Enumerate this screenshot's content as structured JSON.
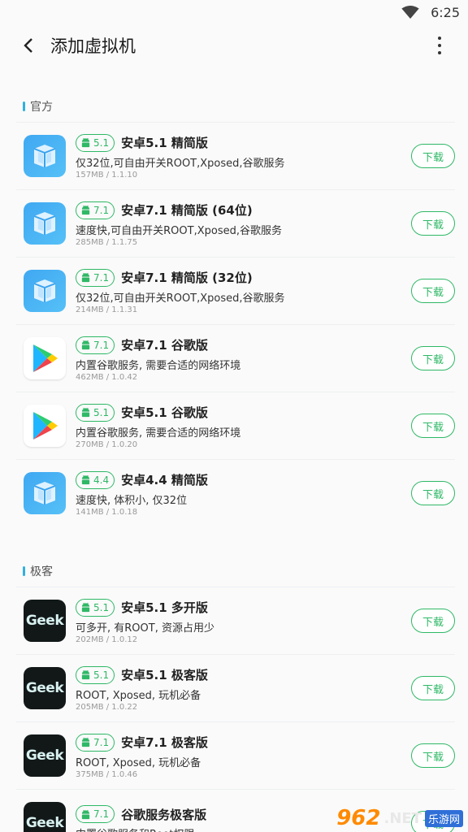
{
  "status": {
    "time": "6:25"
  },
  "header": {
    "title": "添加虚拟机"
  },
  "sections": [
    {
      "title": "官方",
      "items": [
        {
          "icon": "box-icon",
          "version": "5.1",
          "name": "安卓5.1 精简版",
          "desc": "仅32位,可自由开关ROOT,Xposed,谷歌服务",
          "meta": "157MB / 1.1.10",
          "button": "下载"
        },
        {
          "icon": "box-icon",
          "version": "7.1",
          "name": "安卓7.1 精简版 (64位)",
          "desc": "速度快,可自由开关ROOT,Xposed,谷歌服务",
          "meta": "285MB / 1.1.75",
          "button": "下载"
        },
        {
          "icon": "box-icon",
          "version": "7.1",
          "name": "安卓7.1 精简版 (32位)",
          "desc": "仅32位,可自由开关ROOT,Xposed,谷歌服务",
          "meta": "214MB / 1.1.31",
          "button": "下载"
        },
        {
          "icon": "play-icon",
          "version": "7.1",
          "name": "安卓7.1 谷歌版",
          "desc": "内置谷歌服务, 需要合适的网络环境",
          "meta": "462MB / 1.0.42",
          "button": "下载"
        },
        {
          "icon": "play-icon",
          "version": "5.1",
          "name": "安卓5.1 谷歌版",
          "desc": "内置谷歌服务, 需要合适的网络环境",
          "meta": "270MB / 1.0.20",
          "button": "下载"
        },
        {
          "icon": "box-icon",
          "version": "4.4",
          "name": "安卓4.4 精简版",
          "desc": "速度快, 体积小, 仅32位",
          "meta": "141MB / 1.0.18",
          "button": "下载"
        }
      ]
    },
    {
      "title": "极客",
      "items": [
        {
          "icon": "geek-icon",
          "version": "5.1",
          "name": "安卓5.1 多开版",
          "desc": "可多开, 有ROOT, 资源占用少",
          "meta": "202MB / 1.0.12",
          "button": "下载"
        },
        {
          "icon": "geek-icon",
          "version": "5.1",
          "name": "安卓5.1 极客版",
          "desc": "ROOT, Xposed, 玩机必备",
          "meta": "205MB / 1.0.22",
          "button": "下载"
        },
        {
          "icon": "geek-icon",
          "version": "7.1",
          "name": "安卓7.1 极客版",
          "desc": "ROOT, Xposed, 玩机必备",
          "meta": "375MB / 1.0.46",
          "button": "下载"
        },
        {
          "icon": "geek-icon",
          "version": "7.1",
          "name": "谷歌服务极客版",
          "desc": "内置谷歌服务和Root权限",
          "meta": "",
          "button": "下载"
        }
      ]
    }
  ],
  "geek_logo_text": "Geek",
  "watermark": {
    "num": "962",
    "net": ".NET",
    "badge": "乐游网"
  }
}
